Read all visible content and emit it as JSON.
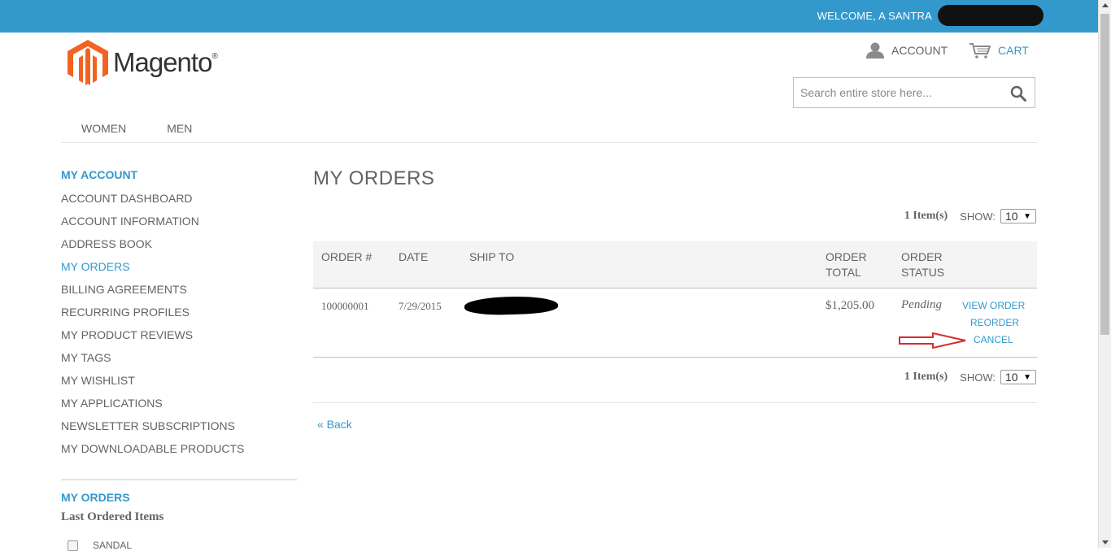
{
  "header": {
    "welcome_text": "WELCOME, A      SANTRA",
    "account_label": "ACCOUNT",
    "cart_label": "CART",
    "logo_text": "Magento",
    "logo_reg": "®",
    "search_placeholder": "Search entire store here..."
  },
  "nav": {
    "items": [
      {
        "label": "WOMEN"
      },
      {
        "label": "MEN"
      }
    ]
  },
  "sidebar": {
    "title": "MY ACCOUNT",
    "items": [
      {
        "label": "ACCOUNT DASHBOARD"
      },
      {
        "label": "ACCOUNT INFORMATION"
      },
      {
        "label": "ADDRESS BOOK"
      },
      {
        "label": "MY ORDERS"
      },
      {
        "label": "BILLING AGREEMENTS"
      },
      {
        "label": "RECURRING PROFILES"
      },
      {
        "label": "MY PRODUCT REVIEWS"
      },
      {
        "label": "MY TAGS"
      },
      {
        "label": "MY WISHLIST"
      },
      {
        "label": "MY APPLICATIONS"
      },
      {
        "label": "NEWSLETTER SUBSCRIPTIONS"
      },
      {
        "label": "MY DOWNLOADABLE PRODUCTS"
      }
    ],
    "active_index": 3,
    "block2_title": "MY ORDERS",
    "block2_subtitle": "Last Ordered Items",
    "last_item": "SANDAL"
  },
  "main": {
    "title": "MY ORDERS",
    "item_count": "1 Item(s)",
    "show_label": "SHOW:",
    "show_value": "10",
    "columns": {
      "order_num": "ORDER #",
      "date": "DATE",
      "ship_to": "SHIP TO",
      "order_total_1": "ORDER",
      "order_total_2": "TOTAL",
      "order_status_1": "ORDER",
      "order_status_2": "STATUS"
    },
    "row": {
      "order_num": "100000001",
      "date": "7/29/2015",
      "total": "$1,205.00",
      "status": "Pending",
      "view_order": "VIEW ORDER",
      "reorder": "REORDER",
      "cancel": "CANCEL"
    },
    "back_label": "« Back"
  },
  "colors": {
    "accent": "#3399cc",
    "topbar": "#3399cc",
    "text": "#636363",
    "annotation_arrow": "#d32f2f",
    "logo_orange": "#f26322"
  },
  "icons": {
    "account": "user-icon",
    "cart": "cart-icon",
    "search": "search-icon"
  }
}
